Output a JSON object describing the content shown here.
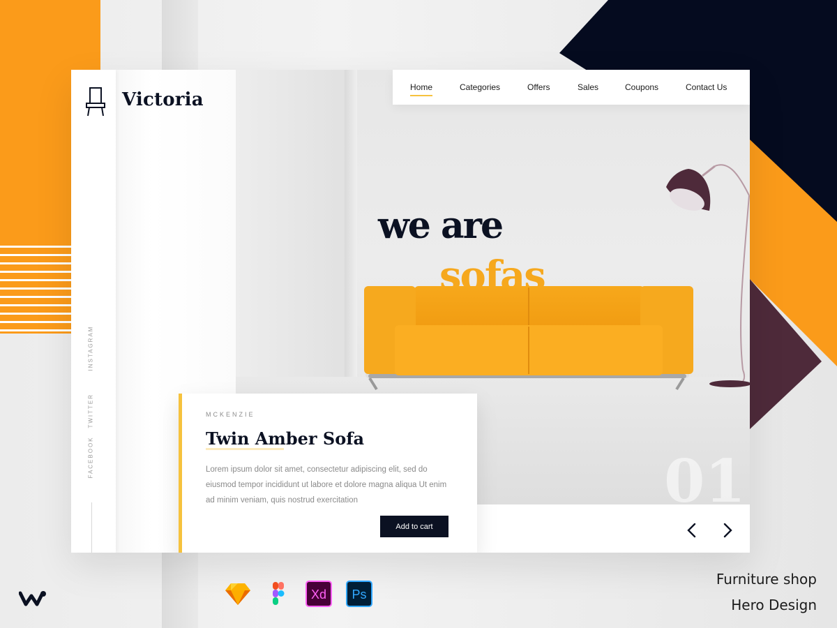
{
  "brand": {
    "name": "Victoria"
  },
  "nav": {
    "items": [
      "Home",
      "Categories",
      "Offers",
      "Sales",
      "Coupons",
      "Contact Us"
    ],
    "active": "Home"
  },
  "social": [
    "INSTAGRAM",
    "TWITTER",
    "FACEBOOK"
  ],
  "hero": {
    "line1": "we are",
    "line2": "sofas",
    "slide_number": "01"
  },
  "product": {
    "brand": "MCKENZIE",
    "title": "Twin Amber Sofa",
    "description": "Lorem ipsum dolor sit amet, consectetur adipiscing elit, sed do eiusmod tempor incididunt ut labore et dolore magna aliqua Ut enim ad minim veniam, quis nostrud exercitation",
    "button": "Add to cart"
  },
  "tools": [
    "Sketch",
    "Figma",
    "Xd",
    "Ps"
  ],
  "caption": {
    "line1": "Furniture shop",
    "line2": "Hero Design"
  },
  "colors": {
    "accent_orange": "#fb9b1a",
    "accent_yellow": "#f6c23e",
    "navy": "#0b1122",
    "plum": "#4e2a3a"
  },
  "icons": [
    "chair-icon",
    "arrow-left-icon",
    "arrow-right-icon",
    "sketch-icon",
    "figma-icon",
    "xd-icon",
    "ps-icon",
    "wm-logo-icon"
  ]
}
